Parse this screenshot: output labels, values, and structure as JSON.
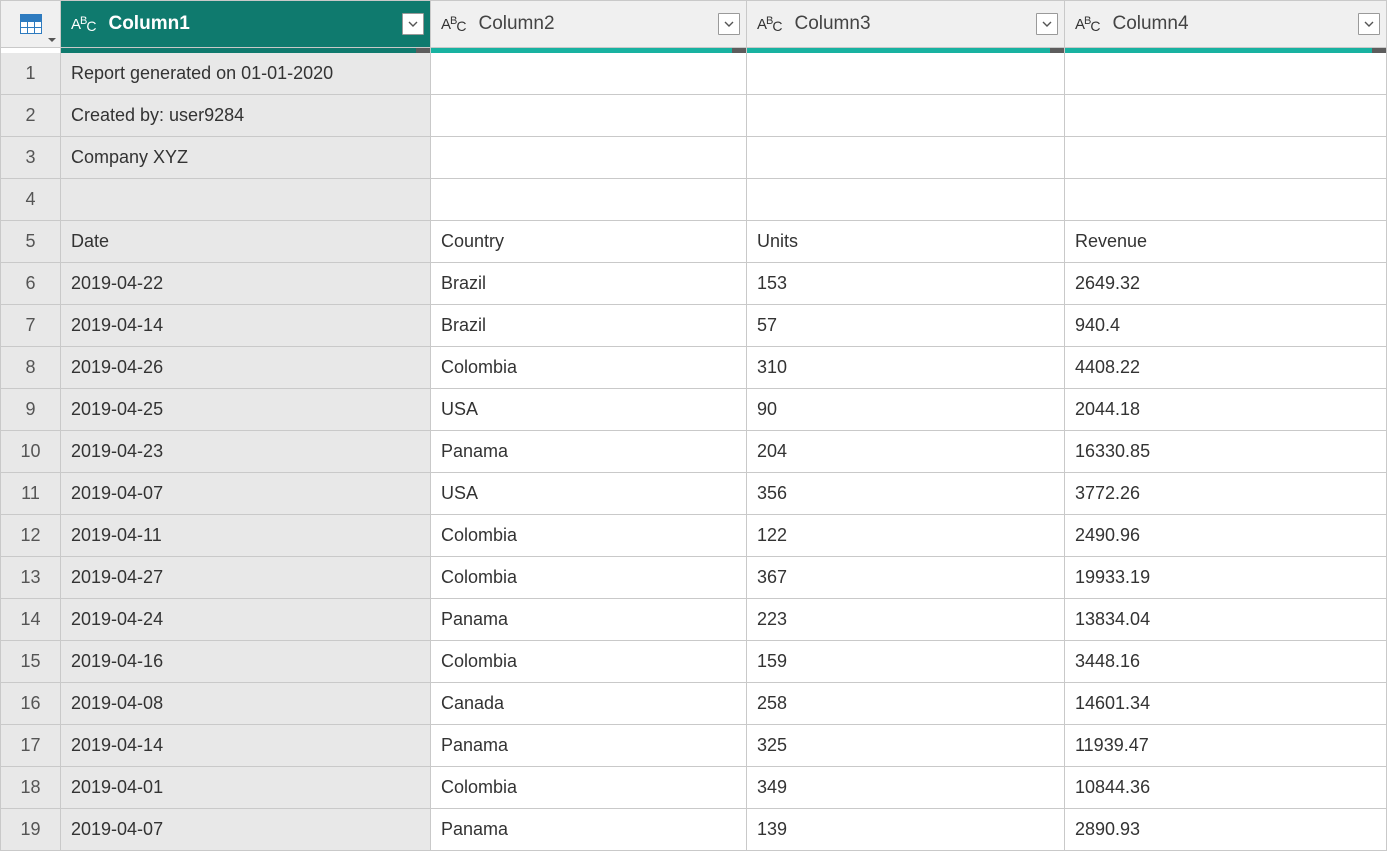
{
  "header": {
    "columns": [
      {
        "label": "Column1",
        "type": "ABC",
        "selected": true
      },
      {
        "label": "Column2",
        "type": "ABC",
        "selected": false
      },
      {
        "label": "Column3",
        "type": "ABC",
        "selected": false
      },
      {
        "label": "Column4",
        "type": "ABC",
        "selected": false
      }
    ]
  },
  "rows": [
    {
      "n": "1",
      "c1": "Report generated on 01-01-2020",
      "c2": "",
      "c3": "",
      "c4": ""
    },
    {
      "n": "2",
      "c1": "Created by: user9284",
      "c2": "",
      "c3": "",
      "c4": ""
    },
    {
      "n": "3",
      "c1": "Company XYZ",
      "c2": "",
      "c3": "",
      "c4": ""
    },
    {
      "n": "4",
      "c1": "",
      "c2": "",
      "c3": "",
      "c4": ""
    },
    {
      "n": "5",
      "c1": "Date",
      "c2": "Country",
      "c3": "Units",
      "c4": "Revenue"
    },
    {
      "n": "6",
      "c1": "2019-04-22",
      "c2": "Brazil",
      "c3": "153",
      "c4": "2649.32"
    },
    {
      "n": "7",
      "c1": "2019-04-14",
      "c2": "Brazil",
      "c3": "57",
      "c4": "940.4"
    },
    {
      "n": "8",
      "c1": "2019-04-26",
      "c2": "Colombia",
      "c3": "310",
      "c4": "4408.22"
    },
    {
      "n": "9",
      "c1": "2019-04-25",
      "c2": "USA",
      "c3": "90",
      "c4": "2044.18"
    },
    {
      "n": "10",
      "c1": "2019-04-23",
      "c2": "Panama",
      "c3": "204",
      "c4": "16330.85"
    },
    {
      "n": "11",
      "c1": "2019-04-07",
      "c2": "USA",
      "c3": "356",
      "c4": "3772.26"
    },
    {
      "n": "12",
      "c1": "2019-04-11",
      "c2": "Colombia",
      "c3": "122",
      "c4": "2490.96"
    },
    {
      "n": "13",
      "c1": "2019-04-27",
      "c2": "Colombia",
      "c3": "367",
      "c4": "19933.19"
    },
    {
      "n": "14",
      "c1": "2019-04-24",
      "c2": "Panama",
      "c3": "223",
      "c4": "13834.04"
    },
    {
      "n": "15",
      "c1": "2019-04-16",
      "c2": "Colombia",
      "c3": "159",
      "c4": "3448.16"
    },
    {
      "n": "16",
      "c1": "2019-04-08",
      "c2": "Canada",
      "c3": "258",
      "c4": "14601.34"
    },
    {
      "n": "17",
      "c1": "2019-04-14",
      "c2": "Panama",
      "c3": "325",
      "c4": "11939.47"
    },
    {
      "n": "18",
      "c1": "2019-04-01",
      "c2": "Colombia",
      "c3": "349",
      "c4": "10844.36"
    },
    {
      "n": "19",
      "c1": "2019-04-07",
      "c2": "Panama",
      "c3": "139",
      "c4": "2890.93"
    }
  ]
}
